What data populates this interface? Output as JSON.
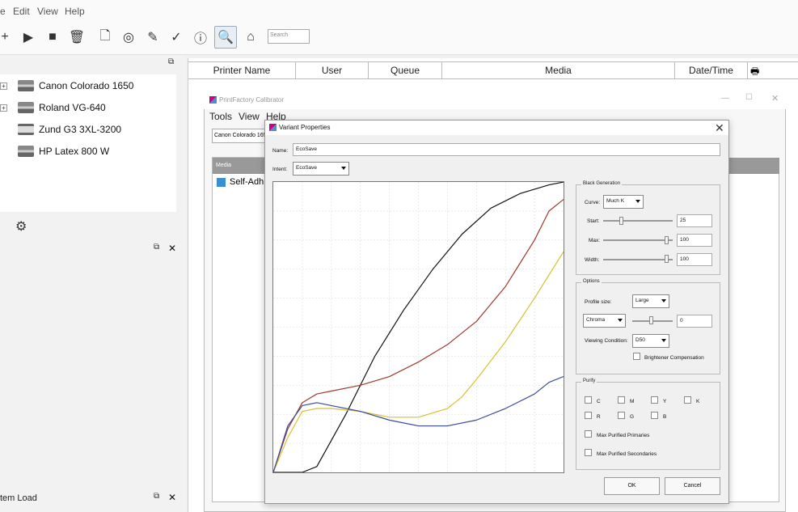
{
  "menubar": {
    "items": [
      "e",
      "Edit",
      "View",
      "Help"
    ]
  },
  "toolbar": {
    "search_placeholder": "Search"
  },
  "tree": {
    "items": [
      {
        "label": "Canon Colorado 1650",
        "expandable": true
      },
      {
        "label": "Roland VG-640",
        "expandable": true
      },
      {
        "label": "Zund G3 3XL-3200",
        "expandable": false
      },
      {
        "label": "HP Latex 800 W",
        "expandable": false
      }
    ]
  },
  "left_bottom": {
    "label": "tem Load"
  },
  "queue": {
    "columns": [
      "Printer Name",
      "User",
      "Queue",
      "Media",
      "Date/Time"
    ]
  },
  "calibrator": {
    "title": "PrintFactory Calibrator",
    "menu": [
      "Tools",
      "View",
      "Help"
    ],
    "printer_combo": "Canon Colorado 1650",
    "media_header": "Media",
    "media_item": "Self-Adh"
  },
  "dialog": {
    "title": "Variant Properties",
    "name_label": "Name:",
    "name_value": "EcoSave",
    "intent_label": "Intent:",
    "intent_value": "EcoSave",
    "black_generation": {
      "title": "Black Generation",
      "curve_label": "Curve:",
      "curve_value": "Much K",
      "start_label": "Start:",
      "start_value": "25",
      "max_label": "Max:",
      "max_value": "100",
      "width_label": "Width:",
      "width_value": "100"
    },
    "options": {
      "title": "Options",
      "profile_size_label": "Profile size:",
      "profile_size_value": "Large",
      "chroma_value": "Chroma",
      "chroma_number": "0",
      "viewing_label": "Viewing Condition:",
      "viewing_value": "D50",
      "brightener_label": "Brightener Compensation"
    },
    "purify": {
      "title": "Purify",
      "row1": [
        "C",
        "M",
        "Y",
        "K"
      ],
      "row2": [
        "R",
        "G",
        "B"
      ],
      "max_primaries": "Max Purified Primaries",
      "max_secondaries": "Max Purified Secondaries"
    },
    "ok_label": "OK",
    "cancel_label": "Cancel"
  },
  "chart_data": {
    "type": "line",
    "title": "",
    "xlabel": "",
    "ylabel": "",
    "xlim": [
      0,
      100
    ],
    "ylim": [
      0,
      100
    ],
    "grid": true,
    "series": [
      {
        "color": "#111111",
        "x": [
          0,
          10,
          15,
          25,
          35,
          45,
          55,
          65,
          75,
          85,
          95,
          100
        ],
        "y": [
          0,
          0,
          2,
          20,
          40,
          56,
          70,
          82,
          91,
          96,
          99,
          100
        ]
      },
      {
        "color": "#a0392b",
        "x": [
          0,
          5,
          10,
          15,
          20,
          30,
          40,
          50,
          60,
          70,
          80,
          90,
          95,
          100
        ],
        "y": [
          0,
          15,
          24,
          27,
          28,
          30,
          33,
          38,
          44,
          52,
          64,
          80,
          90,
          94
        ]
      },
      {
        "color": "#d8c230",
        "x": [
          0,
          5,
          10,
          15,
          20,
          30,
          40,
          50,
          60,
          65,
          70,
          80,
          90,
          95,
          100
        ],
        "y": [
          0,
          12,
          21,
          22,
          22,
          21,
          19,
          19,
          22,
          26,
          32,
          45,
          60,
          68,
          76
        ]
      },
      {
        "color": "#3b4a9a",
        "x": [
          0,
          5,
          10,
          15,
          20,
          30,
          40,
          50,
          55,
          60,
          70,
          80,
          90,
          95,
          100
        ],
        "y": [
          0,
          16,
          23,
          24,
          23,
          21,
          18,
          16,
          16,
          16,
          18,
          22,
          27,
          31,
          33
        ]
      }
    ]
  },
  "colors": {
    "accent": "#5a8fc7",
    "title_bar": "#ffffff",
    "dialog_bg": "#f0f0f0"
  }
}
